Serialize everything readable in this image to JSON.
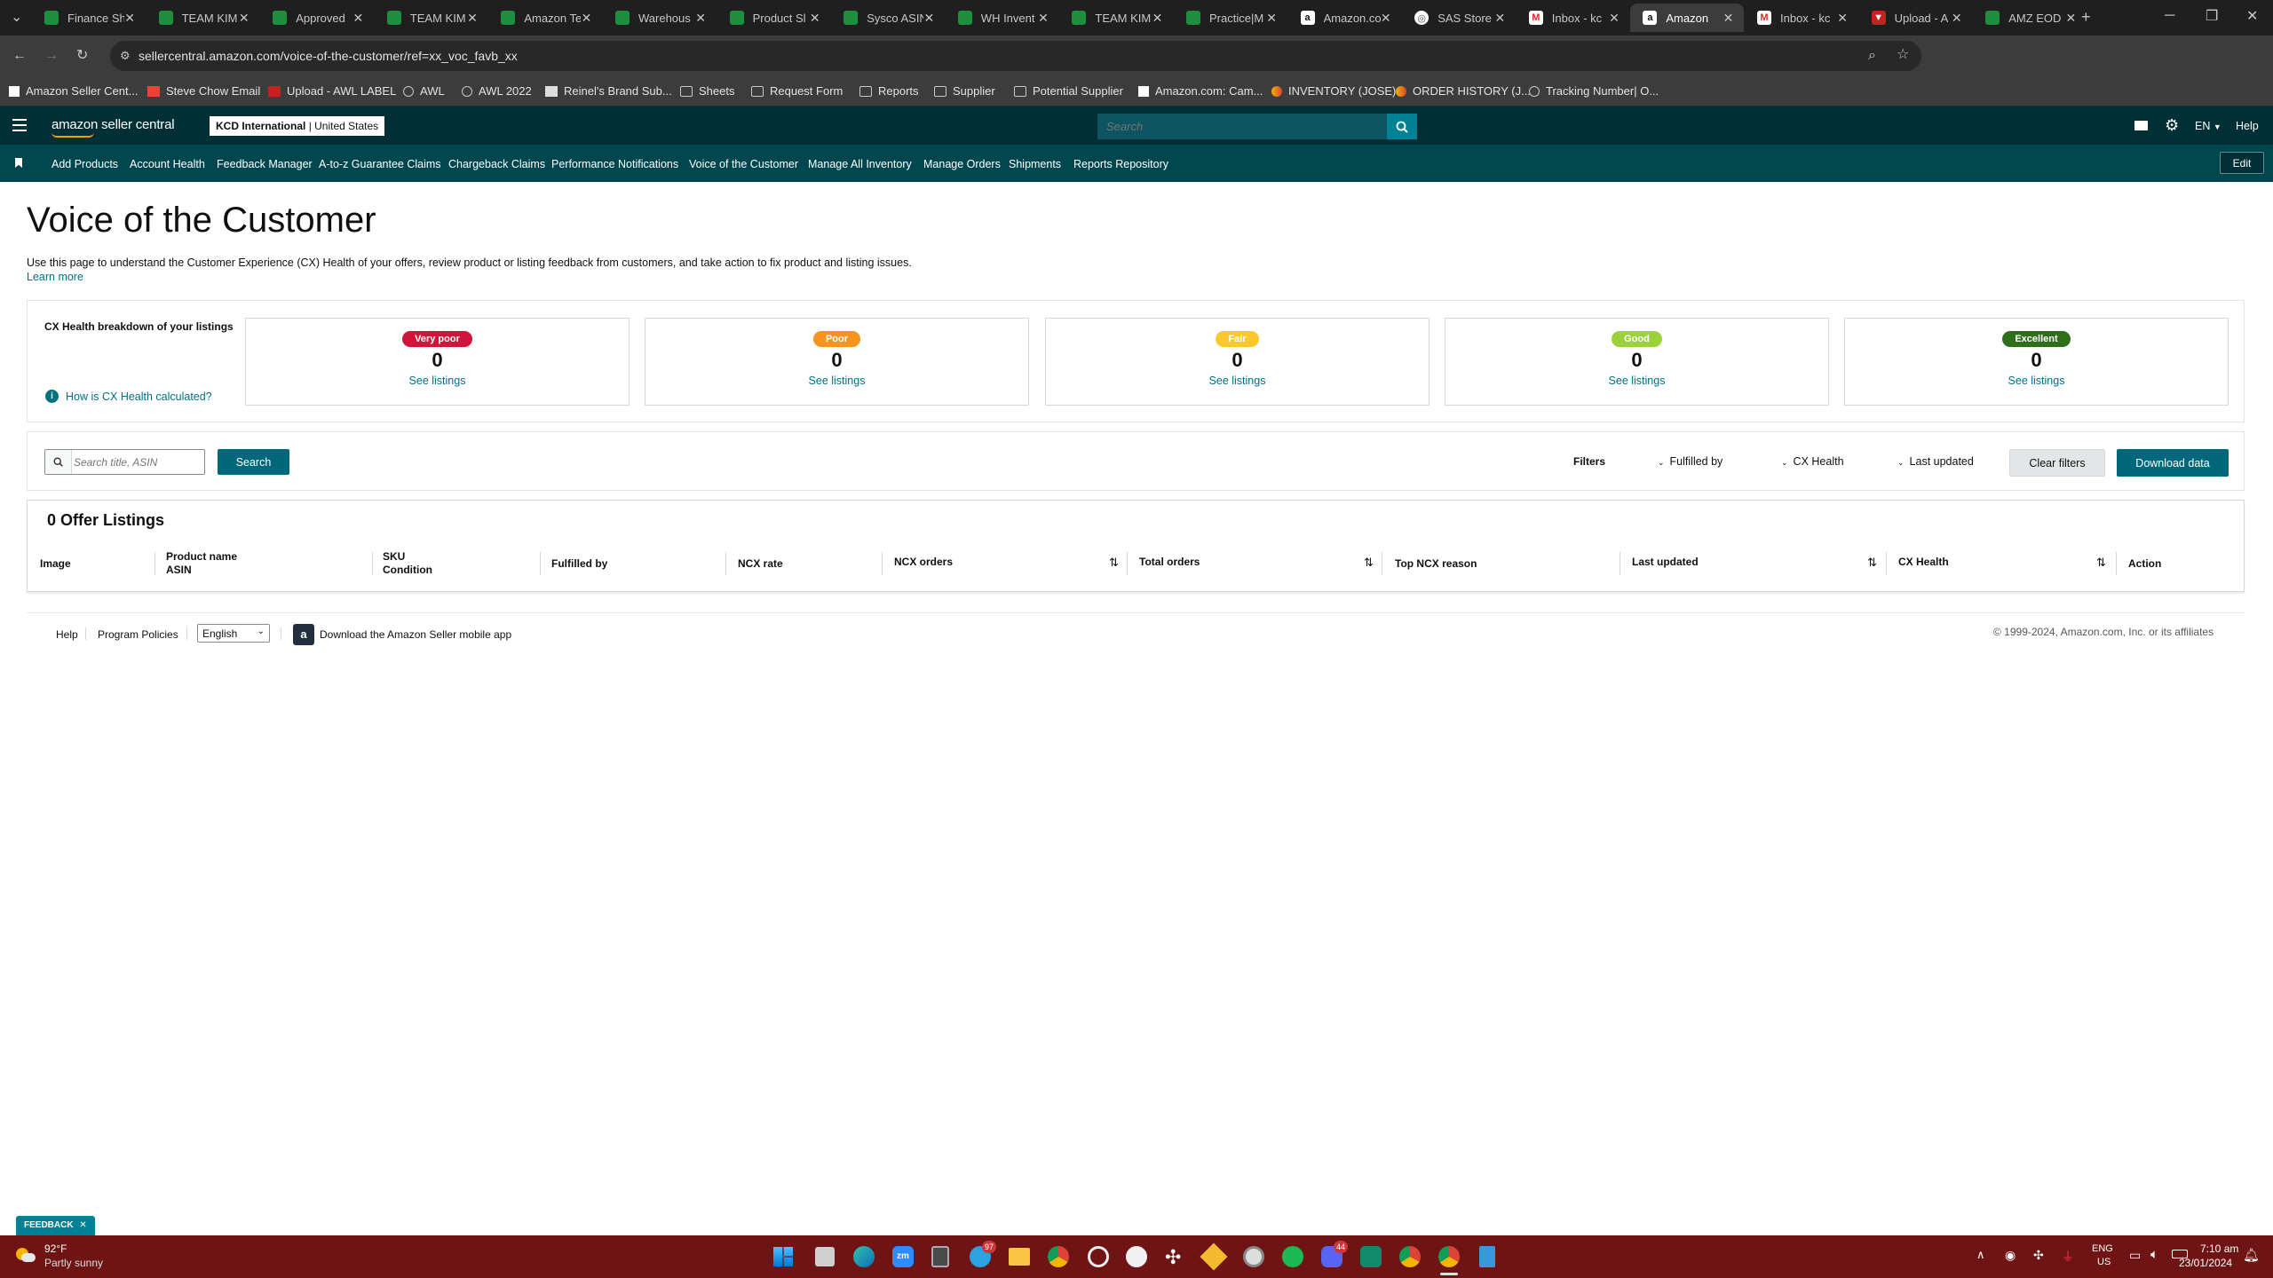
{
  "browser": {
    "tabs": [
      {
        "title": "Finance Sh",
        "icon": "sheets"
      },
      {
        "title": "TEAM KIM",
        "icon": "sheets"
      },
      {
        "title": "Approved",
        "icon": "sheets"
      },
      {
        "title": "TEAM KIM",
        "icon": "sheets"
      },
      {
        "title": "Amazon Te",
        "icon": "sheets"
      },
      {
        "title": "Warehous",
        "icon": "sheets"
      },
      {
        "title": "Product Sl",
        "icon": "sheets"
      },
      {
        "title": "Sysco ASIN",
        "icon": "sheets"
      },
      {
        "title": "WH Invent",
        "icon": "sheets"
      },
      {
        "title": "TEAM KIM",
        "icon": "sheets"
      },
      {
        "title": "Practice|M",
        "icon": "sheets"
      },
      {
        "title": "Amazon.co",
        "icon": "amazon"
      },
      {
        "title": "SAS Store",
        "icon": "sas"
      },
      {
        "title": "Inbox - kc",
        "icon": "gmail"
      },
      {
        "title": "Amazon",
        "icon": "amazon"
      },
      {
        "title": "Inbox - kc",
        "icon": "gmail"
      },
      {
        "title": "Upload - A",
        "icon": "red"
      },
      {
        "title": "AMZ EOD",
        "icon": "sheets"
      }
    ],
    "url": "sellercentral.amazon.com/voice-of-the-customer/ref=xx_voc_favb_xx",
    "bookmarks": [
      {
        "label": "Amazon Seller Cent...",
        "icon": "amazon-icon"
      },
      {
        "label": "Steve Chow Email",
        "icon": "gmail-icon"
      },
      {
        "label": "Upload - AWL LABEL",
        "icon": "awl-icon"
      },
      {
        "label": "AWL",
        "icon": "globe-icon"
      },
      {
        "label": "AWL 2022",
        "icon": "globe-icon"
      },
      {
        "label": "Reinel's Brand Sub...",
        "icon": "brand-icon"
      },
      {
        "label": "Sheets",
        "icon": "folder-icon"
      },
      {
        "label": "Request Form",
        "icon": "folder-icon"
      },
      {
        "label": "Reports",
        "icon": "folder-icon"
      },
      {
        "label": "Supplier",
        "icon": "folder-icon"
      },
      {
        "label": "Potential Supplier",
        "icon": "folder-icon"
      },
      {
        "label": "Amazon.com: Cam...",
        "icon": "amazon-icon"
      },
      {
        "label": "INVENTORY (JOSE)",
        "icon": "apps-script-icon"
      },
      {
        "label": "ORDER HISTORY (J...",
        "icon": "apps-script-icon"
      },
      {
        "label": "Tracking Number| O...",
        "icon": "tracking-icon"
      }
    ]
  },
  "header": {
    "logo": "amazon seller central",
    "store_name": "KCD International",
    "store_region": "United States",
    "search_placeholder": "Search",
    "language": "EN",
    "help": "Help",
    "nav": [
      "Add Products",
      "Account Health",
      "Feedback Manager",
      "A-to-z Guarantee Claims",
      "Chargeback Claims",
      "Performance Notifications",
      "Voice of the Customer",
      "Manage All Inventory",
      "Manage Orders",
      "Shipments",
      "Reports Repository"
    ],
    "edit": "Edit"
  },
  "page": {
    "title": "Voice of the Customer",
    "description": "Use this page to understand the Customer Experience (CX) Health of your offers, review product or listing feedback from customers, and take action to fix product and listing issues.",
    "learn_more": "Learn more"
  },
  "cx_health": {
    "heading": "CX Health breakdown of your listings",
    "how_link": "How is CX Health calculated?",
    "cards": [
      {
        "label": "Very poor",
        "count": "0",
        "link": "See listings",
        "color": "#d1153a",
        "text_color": "#ffffff"
      },
      {
        "label": "Poor",
        "count": "0",
        "link": "See listings",
        "color": "#f7941d",
        "text_color": "#ffffff"
      },
      {
        "label": "Fair",
        "count": "0",
        "link": "See listings",
        "color": "#fcc92d",
        "text_color": "#ffffff"
      },
      {
        "label": "Good",
        "count": "0",
        "link": "See listings",
        "color": "#9ad13c",
        "text_color": "#ffffff"
      },
      {
        "label": "Excellent",
        "count": "0",
        "link": "See listings",
        "color": "#2f6f1b",
        "text_color": "#ffffff"
      }
    ]
  },
  "filters": {
    "search_placeholder": "Search title, ASIN",
    "search_button": "Search",
    "label": "Filters",
    "fulfilled_by": "Fulfilled by",
    "cx_health": "CX Health",
    "last_updated": "Last updated",
    "clear": "Clear filters",
    "download": "Download data"
  },
  "listings": {
    "title": "0 Offer Listings",
    "columns": {
      "image": "Image",
      "product_name": "Product name",
      "asin": "ASIN",
      "sku": "SKU",
      "condition": "Condition",
      "fulfilled_by": "Fulfilled by",
      "ncx_rate": "NCX rate",
      "ncx_orders": "NCX orders",
      "total_orders": "Total orders",
      "top_ncx_reason": "Top NCX reason",
      "last_updated": "Last updated",
      "cx_health": "CX Health",
      "action": "Action"
    }
  },
  "footer": {
    "help": "Help",
    "policies": "Program Policies",
    "language": "English",
    "app": "Download the Amazon Seller mobile app",
    "copyright": "© 1999-2024, Amazon.com, Inc. or its affiliates"
  },
  "feedback": "FEEDBACK",
  "taskbar": {
    "temp": "92°F",
    "weather": "Partly sunny",
    "lang": "ENG",
    "region": "US",
    "time": "7:10 am",
    "date": "23/01/2024",
    "badges": [
      "97",
      "44"
    ]
  }
}
